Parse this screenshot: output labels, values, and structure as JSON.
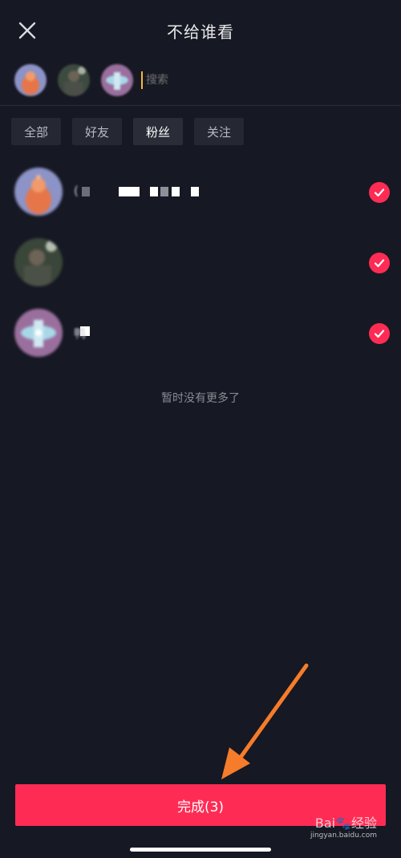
{
  "header": {
    "title": "不给谁看"
  },
  "search": {
    "placeholder": "搜索"
  },
  "tabs": [
    {
      "label": "全部",
      "active": false
    },
    {
      "label": "好友",
      "active": false
    },
    {
      "label": "粉丝",
      "active": true
    },
    {
      "label": "关注",
      "active": false
    }
  ],
  "list": {
    "items": [
      {
        "name": "(",
        "checked": true
      },
      {
        "name": "",
        "checked": true
      },
      {
        "name": "鸭",
        "checked": true
      }
    ],
    "end_text": "暂时没有更多了"
  },
  "footer": {
    "done_label": "完成(3)"
  },
  "watermark": {
    "logo": "Bai🐾经验",
    "url": "jingyan.baidu.com"
  },
  "colors": {
    "background": "#161823",
    "accent": "#fe2c55",
    "annotation_arrow": "#f57c2a"
  }
}
